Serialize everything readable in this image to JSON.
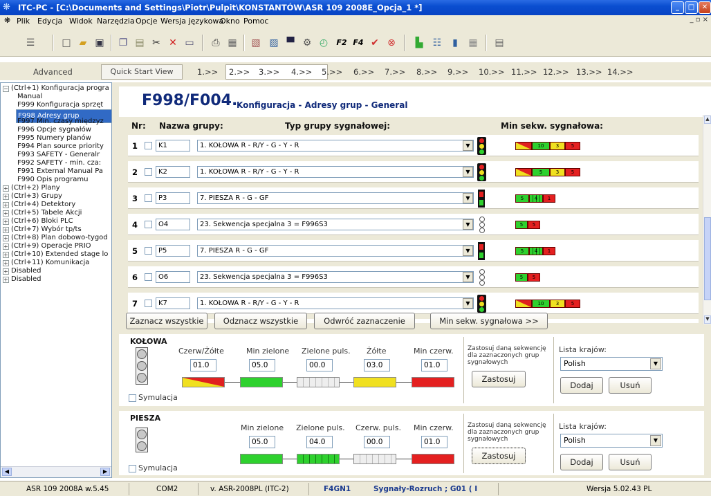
{
  "window": {
    "title": "ITC-PC  - [C:\\Documents and Settings\\Piotr\\Pulpit\\KONSTANTÓW\\ASR 109 2008E_Opcja_1 *]",
    "minimize": "_",
    "maximize": "□",
    "close": "✕"
  },
  "menu": [
    "Plik",
    "Edycja",
    "Widok",
    "Narzędzia",
    "Opcje",
    "Wersja językowa",
    "Okno",
    "Pomoc"
  ],
  "tabs": {
    "advanced": "Advanced",
    "quick_start": "Quick Start View",
    "steps": [
      "1.>>",
      "2.>>",
      "3.>>",
      "4.>>",
      "5.>>",
      "6.>>",
      "7.>>",
      "8.>>",
      "9.>>",
      "10.>>",
      "11.>>",
      "12.>>",
      "13.>>",
      "14.>>"
    ]
  },
  "tree": {
    "nodes": [
      "(Ctrl+1)   Konfiguracja progra",
      "Manual",
      "F999 Konfiguracja sprzęt",
      "F998 Adresy grup",
      "F997 Min. czasy międzyz",
      "F996 Opcje sygnałów",
      "F995 Numery planów",
      "F994 Plan source priority",
      "F993 SAFETY - Generalr",
      "F992 SAFETY - min. cza:",
      "F991 External Manual Pa",
      "F990 Opis programu",
      "(Ctrl+2)   Plany",
      "(Ctrl+3)   Grupy",
      "(Ctrl+4)   Detektory",
      "(Ctrl+5)   Tabele Akcji",
      "(Ctrl+6)   Bloki PLC",
      "(Ctrl+7)   Wybór tp/ts",
      "(Ctrl+8)   Plan dobowo-tygod",
      "(Ctrl+9)   Operacje PRIO",
      "(Ctrl+10)   Extended stage lo",
      "(Ctrl+11)   Komunikacja",
      "Disabled",
      "Disabled"
    ]
  },
  "page": {
    "code": "F998/F004.",
    "subtitle": "Konfiguracja - Adresy grup - General",
    "col_nr": "Nr:",
    "col_name": "Nazwa grupy:",
    "col_type": "Typ grupy sygnałowej:",
    "col_seq": "Min sekw. sygnałowa:"
  },
  "rows": [
    {
      "num": "1",
      "name": "K1",
      "type": "1. KOŁOWA  R - R/Y - G - Y - R",
      "kind": "kolowa",
      "seq": [
        "",
        "10",
        "3",
        "5"
      ]
    },
    {
      "num": "2",
      "name": "K2",
      "type": "1. KOŁOWA  R - R/Y - G - Y - R",
      "kind": "kolowa",
      "seq": [
        "",
        "5",
        "3",
        "5"
      ]
    },
    {
      "num": "3",
      "name": "P3",
      "type": "7.  PIESZA R - G - GF",
      "kind": "piesza",
      "seq": [
        "5",
        "4",
        "1"
      ]
    },
    {
      "num": "4",
      "name": "O4",
      "type": "23. Sekwencja specjalna 3 = F996S3",
      "kind": "special",
      "seq": [
        "5",
        "5"
      ]
    },
    {
      "num": "5",
      "name": "P5",
      "type": "7.  PIESZA R - G - GF",
      "kind": "piesza",
      "seq": [
        "5",
        "4",
        "1"
      ]
    },
    {
      "num": "6",
      "name": "O6",
      "type": "23. Sekwencja specjalna 3 = F996S3",
      "kind": "special",
      "seq": [
        "5",
        "5"
      ]
    },
    {
      "num": "7",
      "name": "K7",
      "type": "1. KOŁOWA  R - R/Y - G - Y - R",
      "kind": "kolowa",
      "seq": [
        "",
        "10",
        "3",
        "5"
      ]
    },
    {
      "num": "8",
      "name": "K8",
      "type": "1. KOŁOWA  R - R/Y - G - Y - R",
      "kind": "kolowa",
      "seq": [
        "",
        "10",
        "3",
        "5"
      ]
    }
  ],
  "buttons": {
    "select_all": "Zaznacz wszystkie",
    "deselect_all": "Odznacz wszystkie",
    "invert": "Odwróć zaznaczenie",
    "min_seq": "Min sekw. sygnałowa >>"
  },
  "kolowa": {
    "title": "KOŁOWA",
    "l1": "Czerw/Żółte",
    "v1": "01.0",
    "l2": "Min zielone",
    "v2": "05.0",
    "l3": "Zielone puls.",
    "v3": "00.0",
    "l4": "Żółte",
    "v4": "03.0",
    "l5": "Min czerw.",
    "v5": "01.0",
    "apply_info": "Zastosuj daną sekwencję dla zaznaczonych grup sygnałowych",
    "apply": "Zastosuj",
    "country_label": "Lista krajów:",
    "country": "Polish",
    "add": "Dodaj",
    "remove": "Usuń",
    "simulation": "Symulacja"
  },
  "piesza": {
    "title": "PIESZA",
    "l1": "Min zielone",
    "v1": "05.0",
    "l2": "Zielone puls.",
    "v2": "04.0",
    "l3": "Czerw. puls.",
    "v3": "00.0",
    "l4": "Min czerw.",
    "v4": "01.0",
    "apply_info": "Zastosuj daną sekwencję dla zaznaczonych grup sygnałowych",
    "apply": "Zastosuj",
    "country_label": "Lista krajów:",
    "country": "Polish",
    "add": "Dodaj",
    "remove": "Usuń",
    "simulation": "Symulacja"
  },
  "status": {
    "s1": "ASR 109 2008A w.5.45",
    "s2": "COM2",
    "s3": "v. ASR-2008PL (ITC-2)",
    "s4": "F4GN1",
    "s5": "Sygnały-Rozruch  ; G01 ( I",
    "s6": "Wersja 5.02.43 PL"
  }
}
